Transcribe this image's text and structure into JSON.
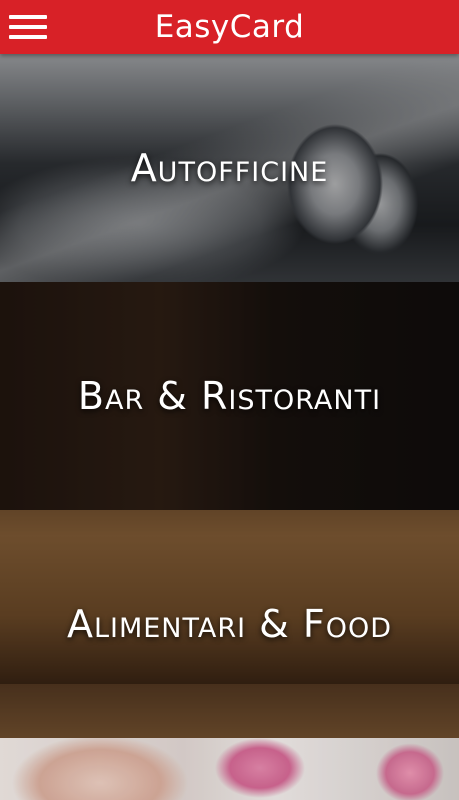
{
  "app": {
    "title": "EasyCard",
    "brand_color": "#d82127"
  },
  "toolbar": {
    "menu_icon": "hamburger-menu-icon"
  },
  "categories": [
    {
      "label": "Autofficine"
    },
    {
      "label": "Bar & Ristoranti"
    },
    {
      "label": "Alimentari & Food"
    },
    {
      "label": ""
    }
  ]
}
